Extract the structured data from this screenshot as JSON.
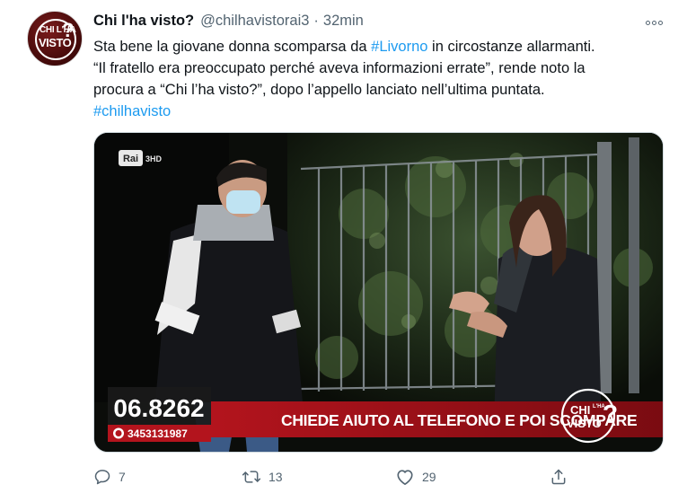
{
  "tweet": {
    "display_name": "Chi l'ha visto?",
    "handle": "@chilhavistorai3",
    "separator": "·",
    "time": "32min",
    "text_lines": [
      {
        "before": "Sta bene la giovane donna scomparsa da ",
        "link": "#Livorno",
        "after": " in circostanze allarmanti."
      },
      {
        "text": "“Il fratello era preoccupato perché aveva informazioni errate”, rende noto la"
      },
      {
        "text": "procura a “Chi l’ha visto?”, dopo l’appello lanciato nell’ultima puntata."
      },
      {
        "link": "#chilhavisto"
      }
    ]
  },
  "avatar": {
    "line1": "CHI L'HA",
    "line2": "VISTO",
    "mark": "?"
  },
  "media": {
    "channel_logo": "Rai",
    "channel_num": "3HD",
    "phone_number": "06.8262",
    "whatsapp_number": "3453131987",
    "caption": "CHIEDE AIUTO AL TELEFONO E POI SCOMPARE",
    "watermark_line1": "CHI",
    "watermark_line2": "VISTO",
    "watermark_small": "L'HA",
    "watermark_mark": "?"
  },
  "actions": {
    "reply_count": "7",
    "retweet_count": "13",
    "like_count": "29"
  },
  "icons": {
    "reply": "reply-icon",
    "retweet": "retweet-icon",
    "like": "heart-icon",
    "share": "share-icon",
    "more": "more-icon",
    "whatsapp": "whatsapp-icon"
  },
  "colors": {
    "link": "#1d9bf0",
    "secondary": "#536471",
    "ticker_red": "#a8121b",
    "avatar_red": "#5a0f0f"
  }
}
